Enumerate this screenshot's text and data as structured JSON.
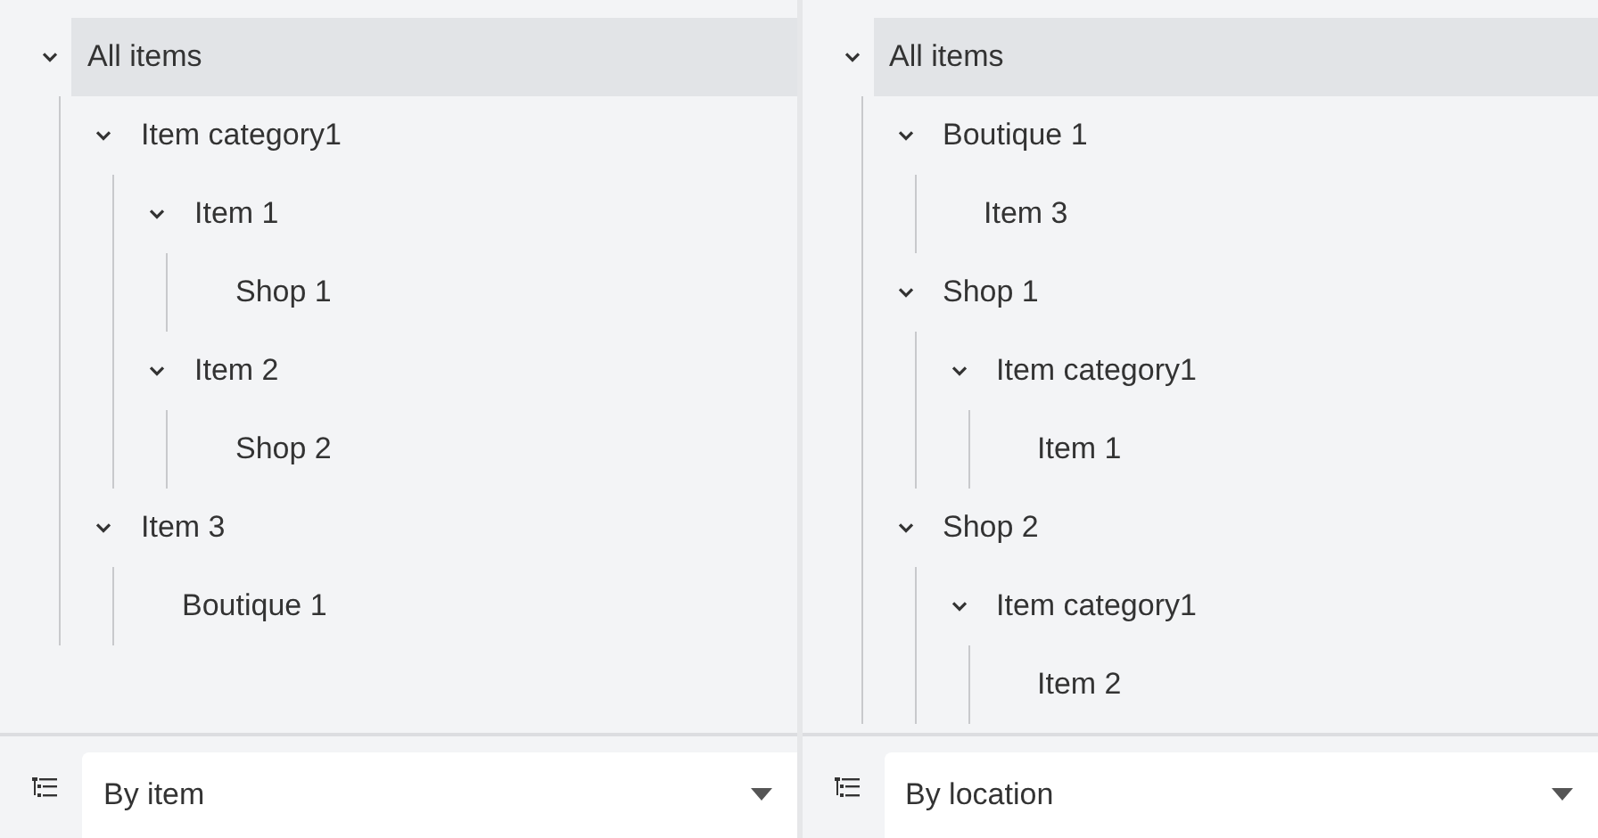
{
  "panels": [
    {
      "tree": [
        {
          "label": "All items",
          "selected": true,
          "expanded": true,
          "children": [
            {
              "label": "Item category1",
              "selected": false,
              "expanded": true,
              "children": [
                {
                  "label": "Item 1",
                  "selected": false,
                  "expanded": true,
                  "children": [
                    {
                      "label": "Shop 1",
                      "selected": false
                    }
                  ]
                },
                {
                  "label": "Item 2",
                  "selected": false,
                  "expanded": true,
                  "children": [
                    {
                      "label": "Shop 2",
                      "selected": false
                    }
                  ]
                }
              ]
            },
            {
              "label": "Item 3",
              "selected": false,
              "expanded": true,
              "children": [
                {
                  "label": "Boutique 1",
                  "selected": false
                }
              ]
            }
          ]
        }
      ],
      "grouping": {
        "value": "By item"
      }
    },
    {
      "tree": [
        {
          "label": "All items",
          "selected": true,
          "expanded": true,
          "children": [
            {
              "label": "Boutique 1",
              "selected": false,
              "expanded": true,
              "children": [
                {
                  "label": "Item 3",
                  "selected": false
                }
              ]
            },
            {
              "label": "Shop 1",
              "selected": false,
              "expanded": true,
              "children": [
                {
                  "label": "Item category1",
                  "selected": false,
                  "expanded": true,
                  "children": [
                    {
                      "label": "Item 1",
                      "selected": false
                    }
                  ]
                }
              ]
            },
            {
              "label": "Shop 2",
              "selected": false,
              "expanded": true,
              "children": [
                {
                  "label": "Item category1",
                  "selected": false,
                  "expanded": true,
                  "children": [
                    {
                      "label": "Item 2",
                      "selected": false
                    }
                  ]
                }
              ]
            }
          ]
        }
      ],
      "grouping": {
        "value": "By location"
      }
    }
  ]
}
